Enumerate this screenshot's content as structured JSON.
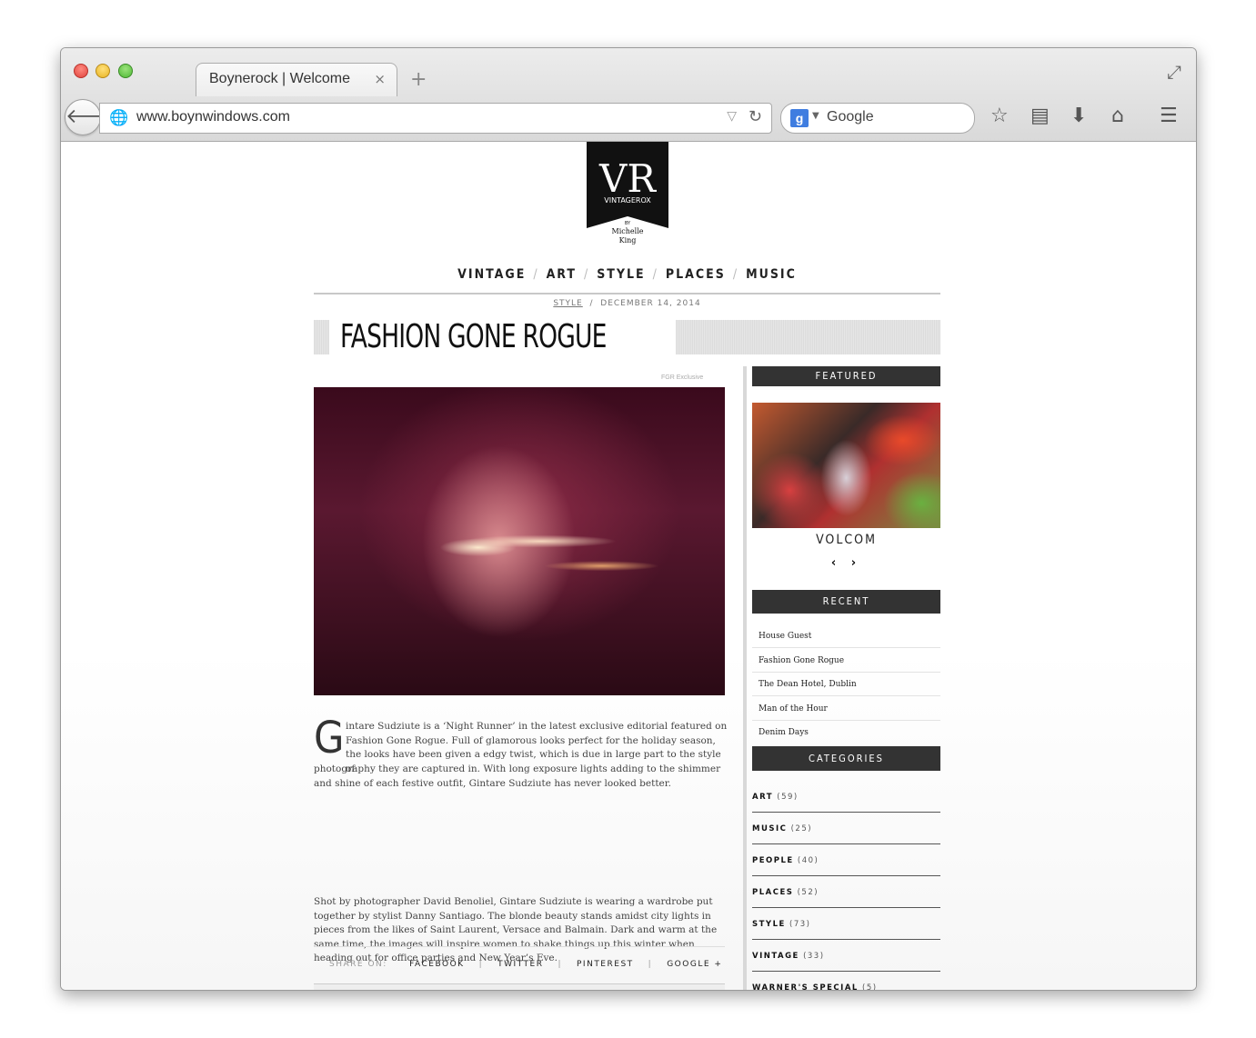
{
  "browser": {
    "tab_title": "Boynerock | Welcome",
    "tab_close": "×",
    "new_tab": "+",
    "url": "www.boynwindows.com",
    "search_engine_badge": "g",
    "search_placeholder": "Google",
    "icons": [
      "back-arrow-icon",
      "globe-icon",
      "dropdown-arrow-icon",
      "reload-icon",
      "star-icon",
      "reading-list-icon",
      "download-icon",
      "home-icon",
      "menu-icon",
      "fullscreen-icon"
    ]
  },
  "logo": {
    "initials": "VR",
    "brand": "VINTAGEROX",
    "by": "BY",
    "author_first": "Michelle",
    "author_last": "King"
  },
  "nav": {
    "items": [
      "VINTAGE",
      "ART",
      "STYLE",
      "PLACES",
      "MUSIC"
    ],
    "separator": "/"
  },
  "article": {
    "category": "STYLE",
    "meta_sep": "/",
    "date": "DECEMBER 14, 2014",
    "title": "FASHION GONE ROGUE",
    "image_credit": "FGR Exclusive",
    "dropcap": "G",
    "p1_first": "intare Sudziute is a ‘Night Runner’ in the latest exclusive editorial featured on Fashion Gone Rogue. Full of glamorous looks perfect for the holiday season, the looks have been given a edgy twist, which is due in large part to the style of",
    "p1_rest": "photography they are captured in. With long exposure lights adding to the shimmer and shine of each festive outfit, Gintare Sudziute has never looked better.",
    "p2": "Shot by photographer David Benoliel, Gintare Sudziute is wearing a wardrobe put together by stylist Danny Santiago. The blonde beauty stands amidst city lights in pieces from the likes of Saint Laurent, Versace and Balmain. Dark and warm at the same time, the images will inspire women to shake things up this winter when heading out for office parties and New Year’s Eve."
  },
  "share": {
    "label": "SHARE ON:",
    "items": [
      "FACEBOOK",
      "TWITTER",
      "PINTEREST",
      "GOOGLE +"
    ],
    "separator": "|"
  },
  "sidebar": {
    "featured_heading": "FEATURED",
    "featured_name": "VOLCOM",
    "prev": "‹",
    "next": "›",
    "recent_heading": "RECENT",
    "recent": [
      "House Guest",
      "Fashion Gone Rogue",
      "The Dean Hotel, Dublin",
      "Man of the Hour",
      "Denim Days"
    ],
    "categories_heading": "CATEGORIES",
    "categories": [
      {
        "name": "ART",
        "count": "(59)"
      },
      {
        "name": "MUSIC",
        "count": "(25)"
      },
      {
        "name": "PEOPLE",
        "count": "(40)"
      },
      {
        "name": "PLACES",
        "count": "(52)"
      },
      {
        "name": "STYLE",
        "count": "(73)"
      },
      {
        "name": "VINTAGE",
        "count": "(33)"
      },
      {
        "name": "WARNER'S SPECIAL",
        "count": "(5)"
      }
    ]
  },
  "colors": {
    "sidebar_heading_bg": "#333333",
    "rule": "#c8c8c8",
    "text": "#444444"
  }
}
